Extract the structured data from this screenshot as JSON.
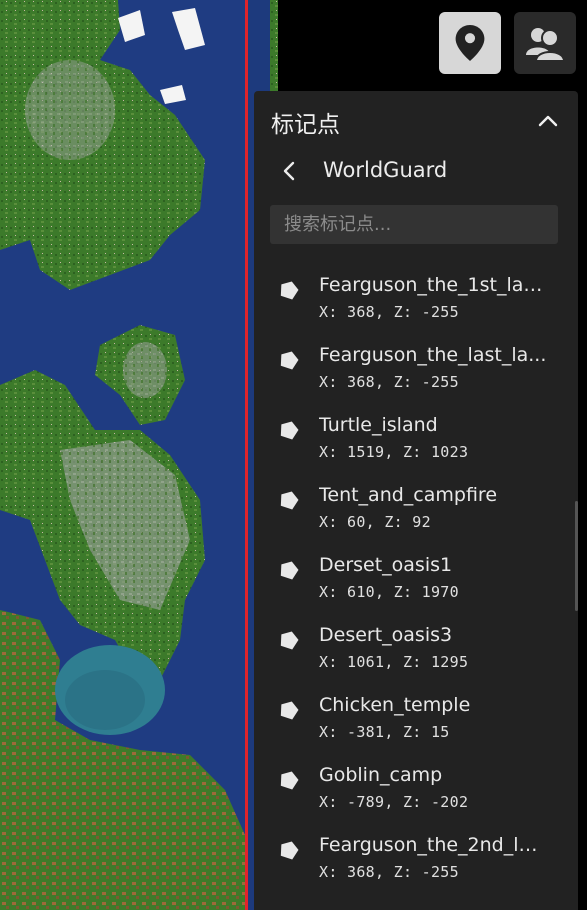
{
  "toolbar": {
    "markers_button": {
      "icon": "map-pin-icon"
    },
    "players_button": {
      "icon": "players-icon"
    }
  },
  "panel": {
    "title": "标记点",
    "collapse_icon": "chevron-up-icon",
    "back": {
      "icon": "chevron-left-icon",
      "label": "WorldGuard"
    },
    "search": {
      "placeholder": "搜索标记点...",
      "value": ""
    },
    "markers": [
      {
        "name": "Fearguson_the_1st_lay...",
        "coords": "X: 368, Z: -255"
      },
      {
        "name": "Fearguson_the_last_la...",
        "coords": "X: 368, Z: -255"
      },
      {
        "name": "Turtle_island",
        "coords": "X: 1519, Z: 1023"
      },
      {
        "name": "Tent_and_campfire",
        "coords": "X: 60, Z: 92"
      },
      {
        "name": "Derset_oasis1",
        "coords": "X: 610, Z: 1970"
      },
      {
        "name": "Desert_oasis3",
        "coords": "X: 1061, Z: 1295"
      },
      {
        "name": "Chicken_temple",
        "coords": "X: -381, Z: 15"
      },
      {
        "name": "Goblin_camp",
        "coords": "X: -789, Z: -202"
      },
      {
        "name": "Fearguson_the_2nd_la...",
        "coords": "X: 368, Z: -255"
      }
    ]
  },
  "colors": {
    "ocean": "#1f3c82",
    "land": "#3f7a2c",
    "region_border": "#e0242b",
    "panel_bg": "#222222",
    "active_button_bg": "#d7d7d7"
  }
}
